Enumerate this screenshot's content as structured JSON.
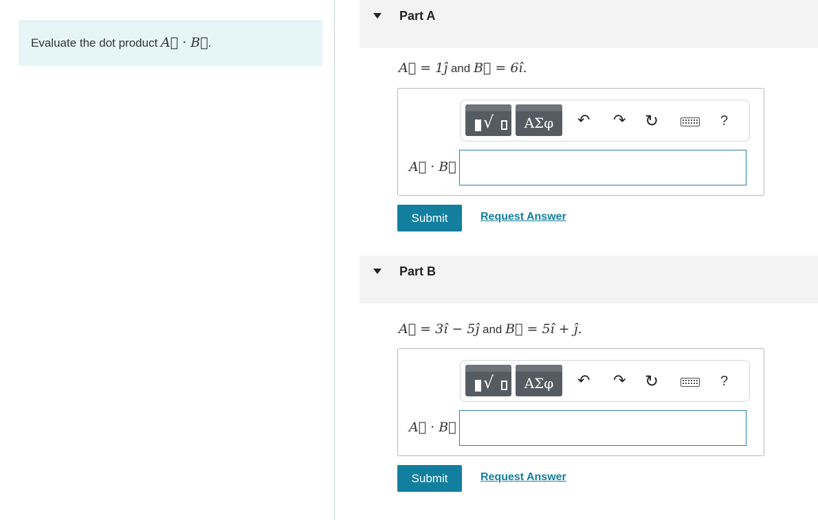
{
  "question": {
    "prompt_prefix": "Evaluate the dot product",
    "prompt_math": "A⃗ · B⃗",
    "prompt_suffix": "."
  },
  "parts": [
    {
      "title": "Part A",
      "given_a": "A⃗ = 1ĵ",
      "given_joiner": "and",
      "given_b": "B⃗ = 6î.",
      "answer_label": "A⃗ · B⃗ =",
      "answer_value": "",
      "submit_label": "Submit",
      "request_label": "Request Answer"
    },
    {
      "title": "Part B",
      "given_a": "A⃗ = 3î − 5ĵ",
      "given_joiner": "and",
      "given_b": "B⃗ = 5î + ĵ.",
      "answer_label": "A⃗ · B⃗ =",
      "answer_value": "",
      "submit_label": "Submit",
      "request_label": "Request Answer"
    }
  ],
  "toolbar": {
    "symbols_label": "ΑΣφ",
    "undo_glyph": "↶",
    "redo_glyph": "↷",
    "reset_glyph": "↻",
    "help_glyph": "?",
    "icons": [
      "templates-icon",
      "symbols-icon",
      "undo-icon",
      "redo-icon",
      "reset-icon",
      "keyboard-icon",
      "help-icon"
    ]
  },
  "colors": {
    "accent": "#127f9e",
    "prompt_background": "#e6f5f6",
    "part_header_background": "#f3f3f3",
    "toolbar_button": "#555b61"
  }
}
